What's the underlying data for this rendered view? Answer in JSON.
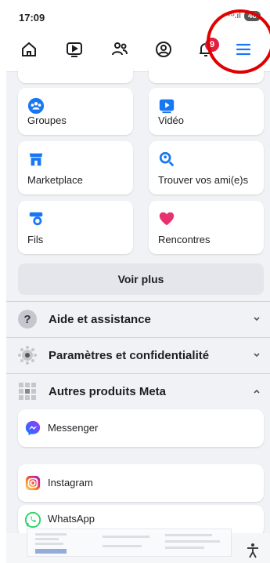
{
  "status_bar": {
    "time": "17:09",
    "signal": "⁴ᴳ.ıl",
    "battery": "48"
  },
  "nav": {
    "items": [
      {
        "name": "home-icon"
      },
      {
        "name": "video-icon"
      },
      {
        "name": "friends-icon"
      },
      {
        "name": "profile-icon"
      },
      {
        "name": "notifications-icon"
      },
      {
        "name": "menu-icon"
      }
    ],
    "notification_count": "9"
  },
  "shortcuts": [
    {
      "label": "Groupes",
      "icon": "groups-icon"
    },
    {
      "label": "Vidéo",
      "icon": "video-icon"
    },
    {
      "label": "Marketplace",
      "icon": "marketplace-icon"
    },
    {
      "label": "Trouver vos ami(e)s",
      "icon": "find-friends-icon"
    },
    {
      "label": "Fils",
      "icon": "feeds-icon"
    },
    {
      "label": "Rencontres",
      "icon": "dating-icon"
    }
  ],
  "see_more_label": "Voir plus",
  "sections": [
    {
      "label": "Aide et assistance",
      "icon": "help-icon",
      "state": "collapsed"
    },
    {
      "label": "Paramètres et confidentialité",
      "icon": "settings-icon",
      "state": "collapsed"
    },
    {
      "label": "Autres produits Meta",
      "icon": "meta-products-icon",
      "state": "expanded"
    }
  ],
  "meta_products": [
    {
      "label": "Messenger",
      "icon": "messenger-icon"
    },
    {
      "label": "Instagram",
      "icon": "instagram-icon"
    },
    {
      "label": "WhatsApp",
      "icon": "whatsapp-icon"
    }
  ],
  "colors": {
    "accent": "#1877f2",
    "badge": "#e41e3f",
    "annotation_circle": "#e00000",
    "background": "#f0f2f5"
  }
}
